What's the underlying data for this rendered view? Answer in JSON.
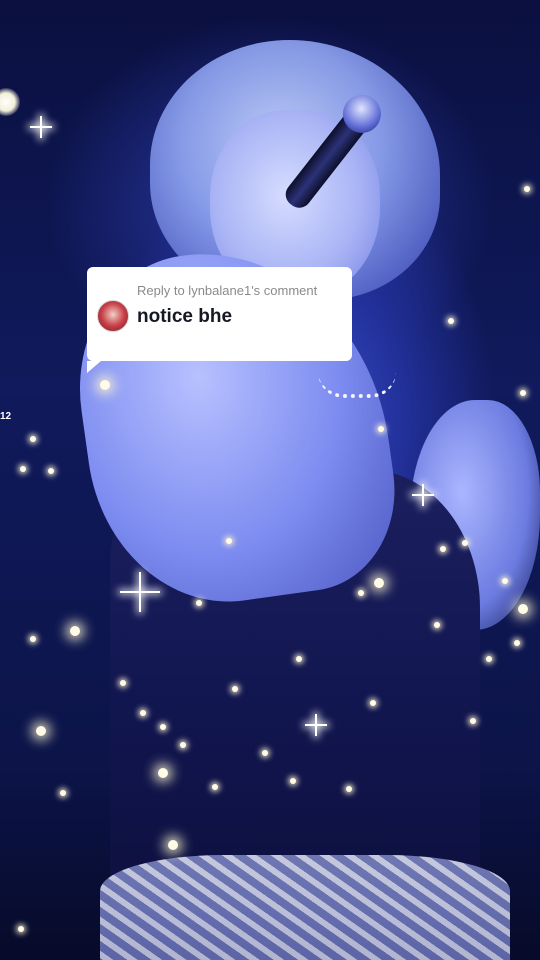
{
  "reply": {
    "heading": "Reply to lynbalane1's comment",
    "text": "notice bhe"
  },
  "edge_label": "12",
  "icons": {
    "avatar": "commenter-avatar",
    "sparkles": "sparkle-icon"
  }
}
